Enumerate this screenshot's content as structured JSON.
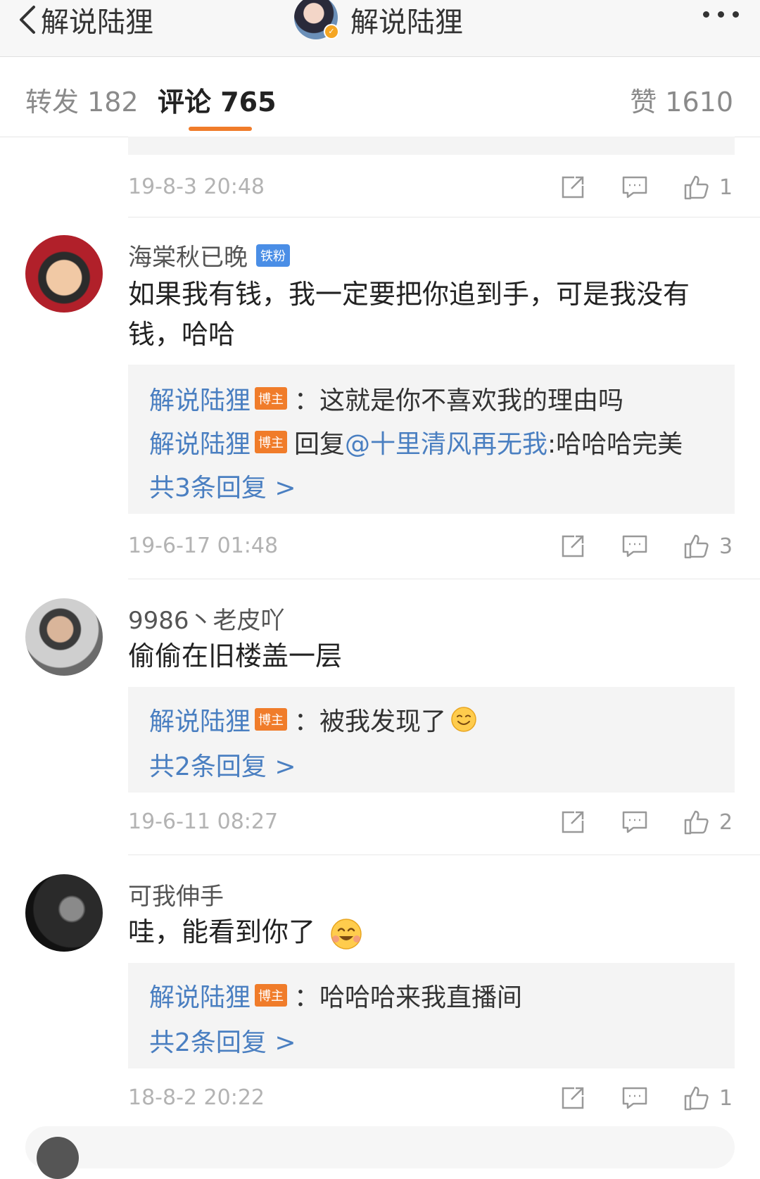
{
  "header": {
    "back_label": "解说陆狸",
    "title": "解说陆狸"
  },
  "tabs": [
    {
      "label": "转发 182"
    },
    {
      "label": "评论 765"
    },
    {
      "label": "赞 1610"
    }
  ],
  "prev_comment": {
    "time": "19-8-3 20:48",
    "likes": "1"
  },
  "comments": [
    {
      "username": "海棠秋已晚",
      "badge": "铁粉",
      "text": "如果我有钱，我一定要把你追到手，可是我没有钱，哈哈",
      "replies": [
        {
          "name": "解说陆狸",
          "badge": "博主",
          "text": "：这就是你不喜欢我的理由吗"
        },
        {
          "name": "解说陆狸",
          "badge": "博主",
          "prefix": "回复",
          "mention": "@十里清风再无我",
          "text": ":哈哈哈完美"
        }
      ],
      "more": "共3条回复 >",
      "time": "19-6-17 01:48",
      "likes": "3"
    },
    {
      "username": "9986丶老皮吖",
      "text": "偷偷在旧楼盖一层",
      "replies": [
        {
          "name": "解说陆狸",
          "badge": "博主",
          "text": "：被我发现了"
        }
      ],
      "more": "共2条回复 >",
      "time": "19-6-11 08:27",
      "likes": "2"
    },
    {
      "username": "可我伸手",
      "text": "哇，能看到你了",
      "replies": [
        {
          "name": "解说陆狸",
          "badge": "博主",
          "text": "：哈哈哈来我直播间"
        }
      ],
      "more": "共2条回复 >",
      "time": "18-8-2 20:22",
      "likes": "1"
    }
  ],
  "colors": {
    "accent": "#f07c2a",
    "link": "#4a7fc1",
    "fan_badge": "#4a8ee6"
  }
}
